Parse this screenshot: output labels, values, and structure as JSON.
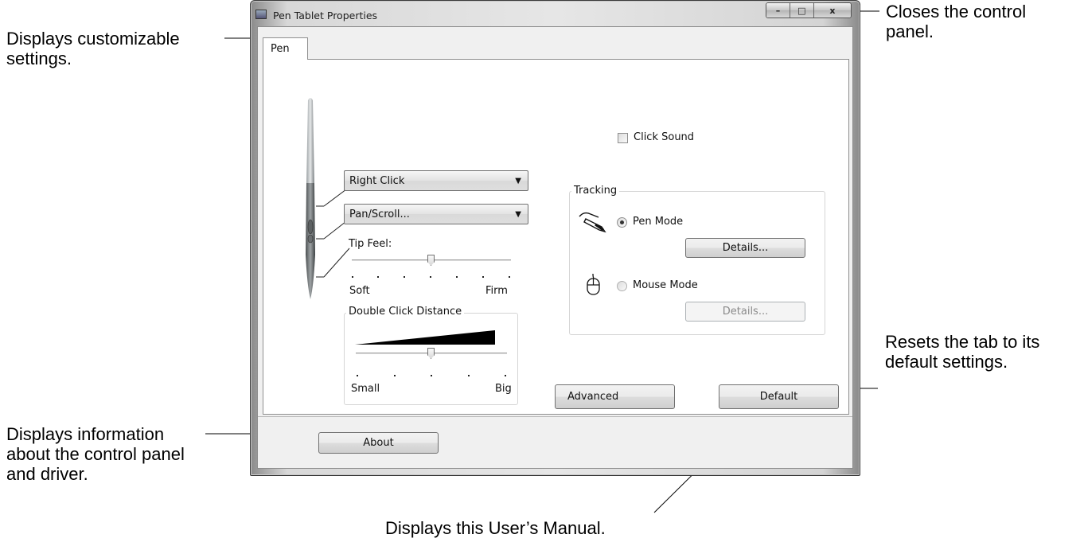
{
  "window": {
    "title": "Pen Tablet Properties",
    "caption_buttons": {
      "minimize": "–",
      "maximize": "□",
      "close": "x"
    }
  },
  "tab": {
    "label": "Pen"
  },
  "pen_buttons": {
    "upper_button": "Right Click",
    "lower_button": "Pan/Scroll..."
  },
  "tip_feel": {
    "label": "Tip Feel:",
    "min_label": "Soft",
    "max_label": "Firm",
    "level": 0.5
  },
  "double_click_distance": {
    "label": "Double Click Distance",
    "min_label": "Small",
    "max_label": "Big",
    "level": 0.5
  },
  "click_sound": {
    "label": "Click Sound",
    "checked": false
  },
  "tracking": {
    "label": "Tracking",
    "pen_mode": {
      "label": "Pen Mode",
      "selected": true,
      "details_label": "Details..."
    },
    "mouse_mode": {
      "label": "Mouse Mode",
      "selected": false,
      "details_label": "Details..."
    }
  },
  "advanced_button": "Advanced",
  "default_button": "Default",
  "about_button": "About",
  "callouts": {
    "tab": "Displays customizable settings.",
    "close": "Closes the control panel.",
    "default": "Resets the tab to its default settings.",
    "about": "Displays information about the control panel and driver.",
    "manual": "Displays this User’s Manual."
  }
}
